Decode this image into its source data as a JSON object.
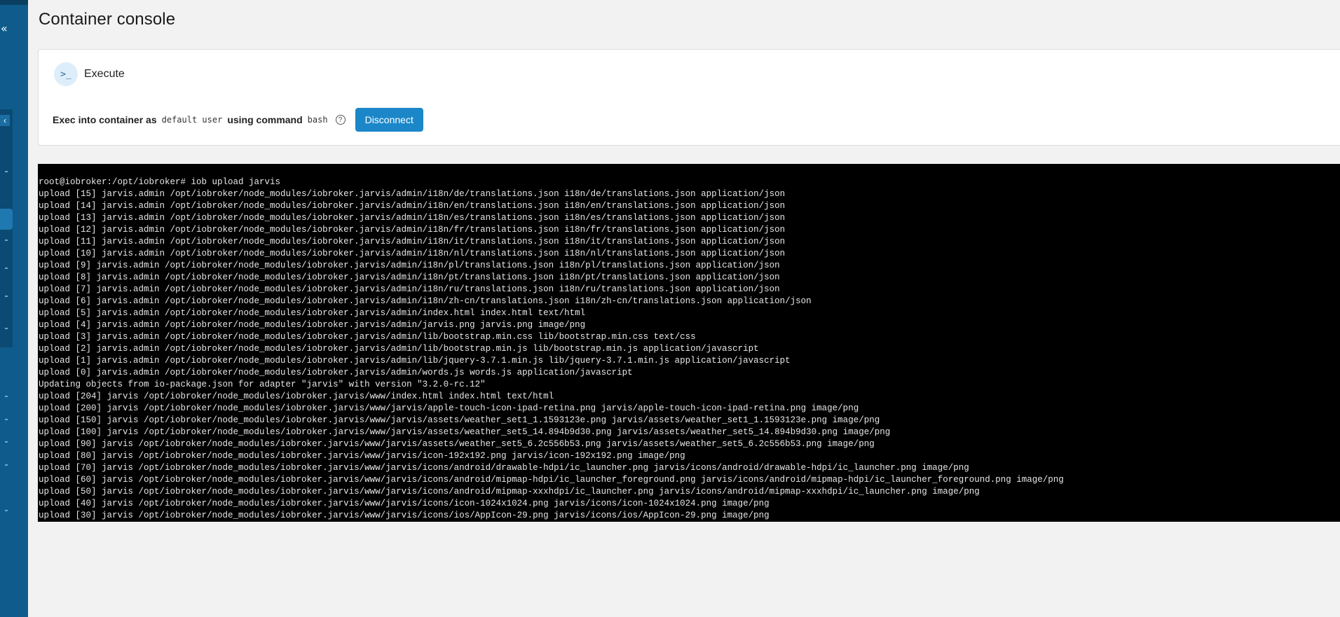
{
  "sidebar": {
    "collapse_glyph": "«",
    "sub_collapse_glyph": "‹"
  },
  "page": {
    "title": "Container console"
  },
  "exec": {
    "icon_glyph": ">_",
    "title": "Execute",
    "label_prefix": "Exec into container as",
    "user": "default user",
    "label_mid": "using command",
    "command": "bash",
    "help_glyph": "?",
    "disconnect_label": "Disconnect"
  },
  "terminal": {
    "lines": [
      "root@iobroker:/opt/iobroker# iob upload jarvis",
      "upload [15] jarvis.admin /opt/iobroker/node_modules/iobroker.jarvis/admin/i18n/de/translations.json i18n/de/translations.json application/json",
      "upload [14] jarvis.admin /opt/iobroker/node_modules/iobroker.jarvis/admin/i18n/en/translations.json i18n/en/translations.json application/json",
      "upload [13] jarvis.admin /opt/iobroker/node_modules/iobroker.jarvis/admin/i18n/es/translations.json i18n/es/translations.json application/json",
      "upload [12] jarvis.admin /opt/iobroker/node_modules/iobroker.jarvis/admin/i18n/fr/translations.json i18n/fr/translations.json application/json",
      "upload [11] jarvis.admin /opt/iobroker/node_modules/iobroker.jarvis/admin/i18n/it/translations.json i18n/it/translations.json application/json",
      "upload [10] jarvis.admin /opt/iobroker/node_modules/iobroker.jarvis/admin/i18n/nl/translations.json i18n/nl/translations.json application/json",
      "upload [9] jarvis.admin /opt/iobroker/node_modules/iobroker.jarvis/admin/i18n/pl/translations.json i18n/pl/translations.json application/json",
      "upload [8] jarvis.admin /opt/iobroker/node_modules/iobroker.jarvis/admin/i18n/pt/translations.json i18n/pt/translations.json application/json",
      "upload [7] jarvis.admin /opt/iobroker/node_modules/iobroker.jarvis/admin/i18n/ru/translations.json i18n/ru/translations.json application/json",
      "upload [6] jarvis.admin /opt/iobroker/node_modules/iobroker.jarvis/admin/i18n/zh-cn/translations.json i18n/zh-cn/translations.json application/json",
      "upload [5] jarvis.admin /opt/iobroker/node_modules/iobroker.jarvis/admin/index.html index.html text/html",
      "upload [4] jarvis.admin /opt/iobroker/node_modules/iobroker.jarvis/admin/jarvis.png jarvis.png image/png",
      "upload [3] jarvis.admin /opt/iobroker/node_modules/iobroker.jarvis/admin/lib/bootstrap.min.css lib/bootstrap.min.css text/css",
      "upload [2] jarvis.admin /opt/iobroker/node_modules/iobroker.jarvis/admin/lib/bootstrap.min.js lib/bootstrap.min.js application/javascript",
      "upload [1] jarvis.admin /opt/iobroker/node_modules/iobroker.jarvis/admin/lib/jquery-3.7.1.min.js lib/jquery-3.7.1.min.js application/javascript",
      "upload [0] jarvis.admin /opt/iobroker/node_modules/iobroker.jarvis/admin/words.js words.js application/javascript",
      "Updating objects from io-package.json for adapter \"jarvis\" with version \"3.2.0-rc.12\"",
      "upload [204] jarvis /opt/iobroker/node_modules/iobroker.jarvis/www/index.html index.html text/html",
      "upload [200] jarvis /opt/iobroker/node_modules/iobroker.jarvis/www/jarvis/apple-touch-icon-ipad-retina.png jarvis/apple-touch-icon-ipad-retina.png image/png",
      "upload [150] jarvis /opt/iobroker/node_modules/iobroker.jarvis/www/jarvis/assets/weather_set1_1.1593123e.png jarvis/assets/weather_set1_1.1593123e.png image/png",
      "upload [100] jarvis /opt/iobroker/node_modules/iobroker.jarvis/www/jarvis/assets/weather_set5_14.894b9d30.png jarvis/assets/weather_set5_14.894b9d30.png image/png",
      "upload [90] jarvis /opt/iobroker/node_modules/iobroker.jarvis/www/jarvis/assets/weather_set5_6.2c556b53.png jarvis/assets/weather_set5_6.2c556b53.png image/png",
      "upload [80] jarvis /opt/iobroker/node_modules/iobroker.jarvis/www/jarvis/icon-192x192.png jarvis/icon-192x192.png image/png",
      "upload [70] jarvis /opt/iobroker/node_modules/iobroker.jarvis/www/jarvis/icons/android/drawable-hdpi/ic_launcher.png jarvis/icons/android/drawable-hdpi/ic_launcher.png image/png",
      "upload [60] jarvis /opt/iobroker/node_modules/iobroker.jarvis/www/jarvis/icons/android/mipmap-hdpi/ic_launcher_foreground.png jarvis/icons/android/mipmap-hdpi/ic_launcher_foreground.png image/png",
      "upload [50] jarvis /opt/iobroker/node_modules/iobroker.jarvis/www/jarvis/icons/android/mipmap-xxxhdpi/ic_launcher.png jarvis/icons/android/mipmap-xxxhdpi/ic_launcher.png image/png",
      "upload [40] jarvis /opt/iobroker/node_modules/iobroker.jarvis/www/jarvis/icons/icon-1024x1024.png jarvis/icons/icon-1024x1024.png image/png",
      "upload [30] jarvis /opt/iobroker/node_modules/iobroker.jarvis/www/jarvis/icons/ios/AppIcon-29.png jarvis/icons/ios/AppIcon-29.png image/png"
    ]
  }
}
